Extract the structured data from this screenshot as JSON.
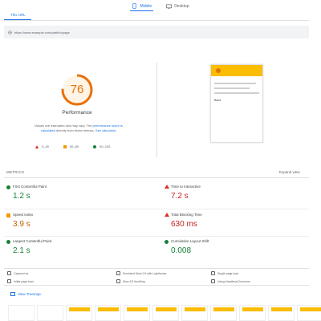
{
  "tabs": [
    {
      "label": "Mobile",
      "icon": "smartphone-icon",
      "active": true
    },
    {
      "label": "Desktop",
      "icon": "monitor-icon",
      "active": false
    }
  ],
  "url_section": {
    "label": "This URL",
    "url": "https://www.example.com/path/to/page"
  },
  "performance": {
    "score": "76",
    "score_value": 76,
    "title": "Performance",
    "note_prefix": "Values are estimated and may vary. The",
    "note_link": "performance score is calculated",
    "note_middle": "directly from these metrics.",
    "note_link2": "See calculator.",
    "legend": [
      {
        "label": "0–49",
        "shape": "triangle",
        "color": "#d93025"
      },
      {
        "label": "50–89",
        "shape": "square",
        "color": "#f29900"
      },
      {
        "label": "90–100",
        "shape": "circle",
        "color": "#188038"
      }
    ],
    "gauge_color": "#e8710a"
  },
  "screenshot_thumb": {
    "header_text": "",
    "intro": "Band",
    "links": [
      "",
      "",
      "",
      ""
    ],
    "footer": ""
  },
  "metrics": {
    "section_label": "METRICS",
    "expand_label": "Expand view",
    "items": [
      {
        "name": "First Contentful Paint",
        "value": "1.2 s",
        "status": "good"
      },
      {
        "name": "Time to Interactive",
        "value": "7.2 s",
        "status": "poor"
      },
      {
        "name": "Speed Index",
        "value": "3.9 s",
        "status": "average"
      },
      {
        "name": "Total Blocking Time",
        "value": "630 ms",
        "status": "poor"
      },
      {
        "name": "Largest Contentful Paint",
        "value": "2.1 s",
        "status": "good"
      },
      {
        "name": "Cumulative Layout Shift",
        "value": "0.008",
        "status": "good"
      }
    ]
  },
  "info": [
    {
      "text": "Captured at",
      "icon": "calendar-icon"
    },
    {
      "text": "Emulated Moto G4 with Lighthouse",
      "icon": "phone-icon"
    },
    {
      "text": "Single page load",
      "icon": "single-load-icon"
    },
    {
      "text": "Initial page load",
      "icon": "timer-icon"
    },
    {
      "text": "Slow 4G throttling",
      "icon": "network-icon"
    },
    {
      "text": "Using HeadlessChromium",
      "icon": "browser-icon"
    }
  ],
  "treemap": {
    "label": "View Treemap"
  },
  "filmstrip": {
    "frames": 11
  }
}
